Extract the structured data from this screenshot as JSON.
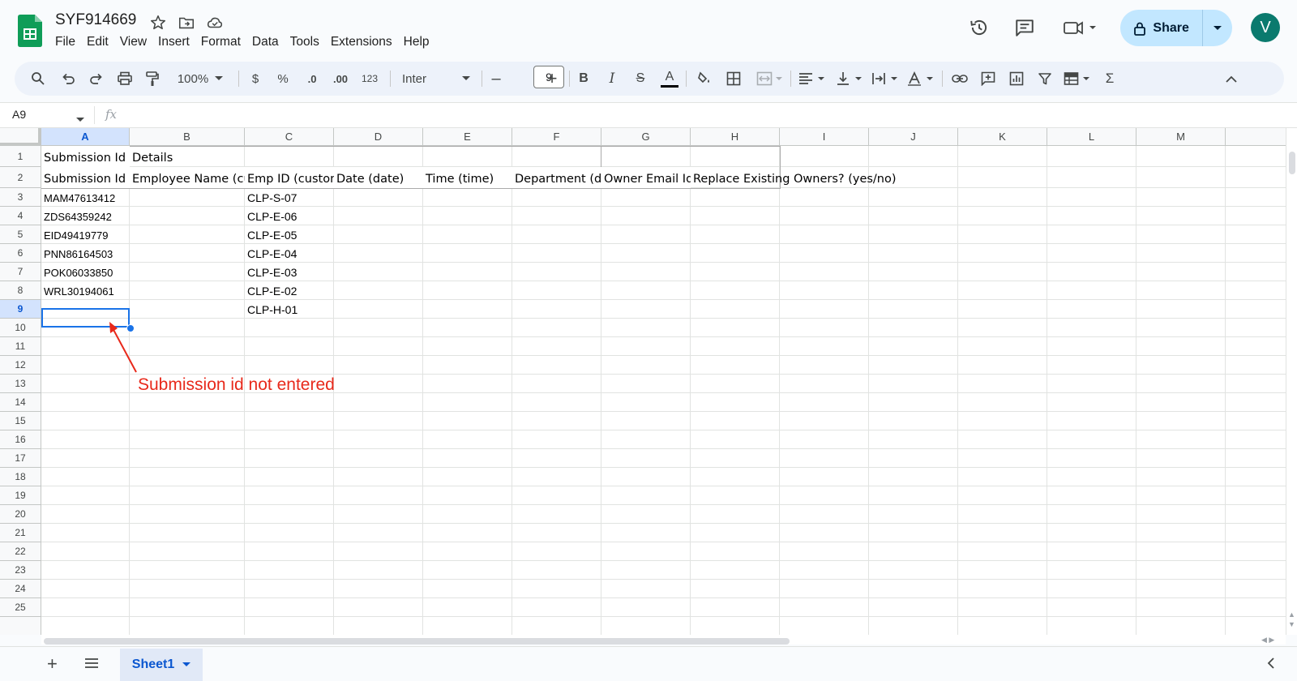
{
  "app": {
    "doc_title": "SYF914669",
    "menu": [
      "File",
      "Edit",
      "View",
      "Insert",
      "Format",
      "Data",
      "Tools",
      "Extensions",
      "Help"
    ],
    "share_label": "Share",
    "avatar_letter": "V",
    "accent_color": "#0b57d0",
    "share_bg": "#c2e7ff"
  },
  "toolbar": {
    "zoom": "100%",
    "currency": "$",
    "percent": "%",
    "dec_decrease": ".0",
    "dec_increase": ".00",
    "number_format": "123",
    "font": "Inter",
    "font_size": "9"
  },
  "formula_bar": {
    "cell_ref": "A9",
    "fx": "fx",
    "value": ""
  },
  "grid": {
    "columns": [
      "A",
      "B",
      "C",
      "D",
      "E",
      "F",
      "G",
      "H",
      "I",
      "J",
      "K",
      "L",
      "M"
    ],
    "selected_column": "A",
    "rows": [
      "1",
      "2",
      "3",
      "4",
      "5",
      "6",
      "7",
      "8",
      "9",
      "10",
      "11",
      "12",
      "13",
      "14",
      "15",
      "16",
      "17",
      "18",
      "19",
      "20",
      "21",
      "22",
      "23",
      "24",
      "25"
    ],
    "selected_row": "9",
    "row1": {
      "A": "Submission Id",
      "B": "Details"
    },
    "row2": {
      "A": "Submission Id",
      "B": "Employee Name (cu",
      "C": "Emp ID (custon",
      "D": "Date (date)",
      "E": "Time (time)",
      "F": "Department (d",
      "G": "Owner Email Id",
      "H": "Replace Existing Owners? (yes/no)"
    },
    "data_rows": [
      {
        "A": "MAM47613412",
        "C": "CLP-S-07"
      },
      {
        "A": "ZDS64359242",
        "C": "CLP-E-06"
      },
      {
        "A": "EID49419779",
        "C": "CLP-E-05"
      },
      {
        "A": "PNN86164503",
        "C": "CLP-E-04"
      },
      {
        "A": "POK06033850",
        "C": "CLP-E-03"
      },
      {
        "A": "WRL30194061",
        "C": "CLP-E-02"
      },
      {
        "A": "",
        "C": "CLP-H-01"
      }
    ]
  },
  "annotation": {
    "text": "Submission id not entered",
    "color": "#e8291b"
  },
  "sheets": {
    "active": "Sheet1"
  }
}
